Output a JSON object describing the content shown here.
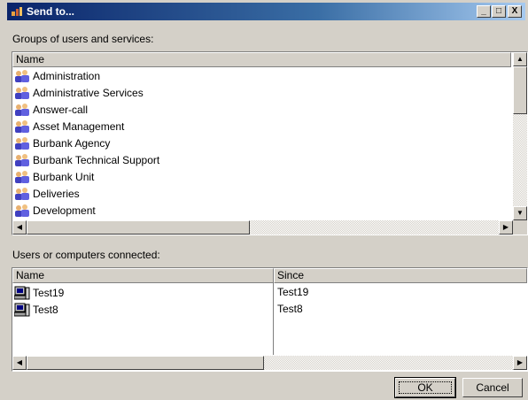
{
  "window": {
    "title": "Send to..."
  },
  "title_buttons": {
    "minimize": "_",
    "maximize": "□",
    "close": "X"
  },
  "groups": {
    "label": "Groups of users and services:",
    "column_name": "Name",
    "items": [
      {
        "label": "Administration",
        "icon": "group-icon"
      },
      {
        "label": "Administrative Services",
        "icon": "group-icon"
      },
      {
        "label": "Answer-call",
        "icon": "group-icon"
      },
      {
        "label": "Asset Management",
        "icon": "group-icon"
      },
      {
        "label": "Burbank Agency",
        "icon": "group-icon"
      },
      {
        "label": "Burbank Technical Support",
        "icon": "group-icon"
      },
      {
        "label": "Burbank Unit",
        "icon": "group-icon"
      },
      {
        "label": "Deliveries",
        "icon": "group-icon"
      },
      {
        "label": "Development",
        "icon": "group-icon"
      }
    ]
  },
  "connected": {
    "label": "Users or computers connected:",
    "columns": [
      "Name",
      "Since"
    ],
    "rows": [
      {
        "name": "Test19",
        "since": "Test19",
        "icon": "computer-icon"
      },
      {
        "name": "Test8",
        "since": "Test8",
        "icon": "computer-icon"
      }
    ]
  },
  "buttons": {
    "ok": "OK",
    "cancel": "Cancel"
  },
  "colors": {
    "title_start": "#0a246a",
    "title_end": "#a6caf0",
    "face": "#d4d0c8"
  }
}
